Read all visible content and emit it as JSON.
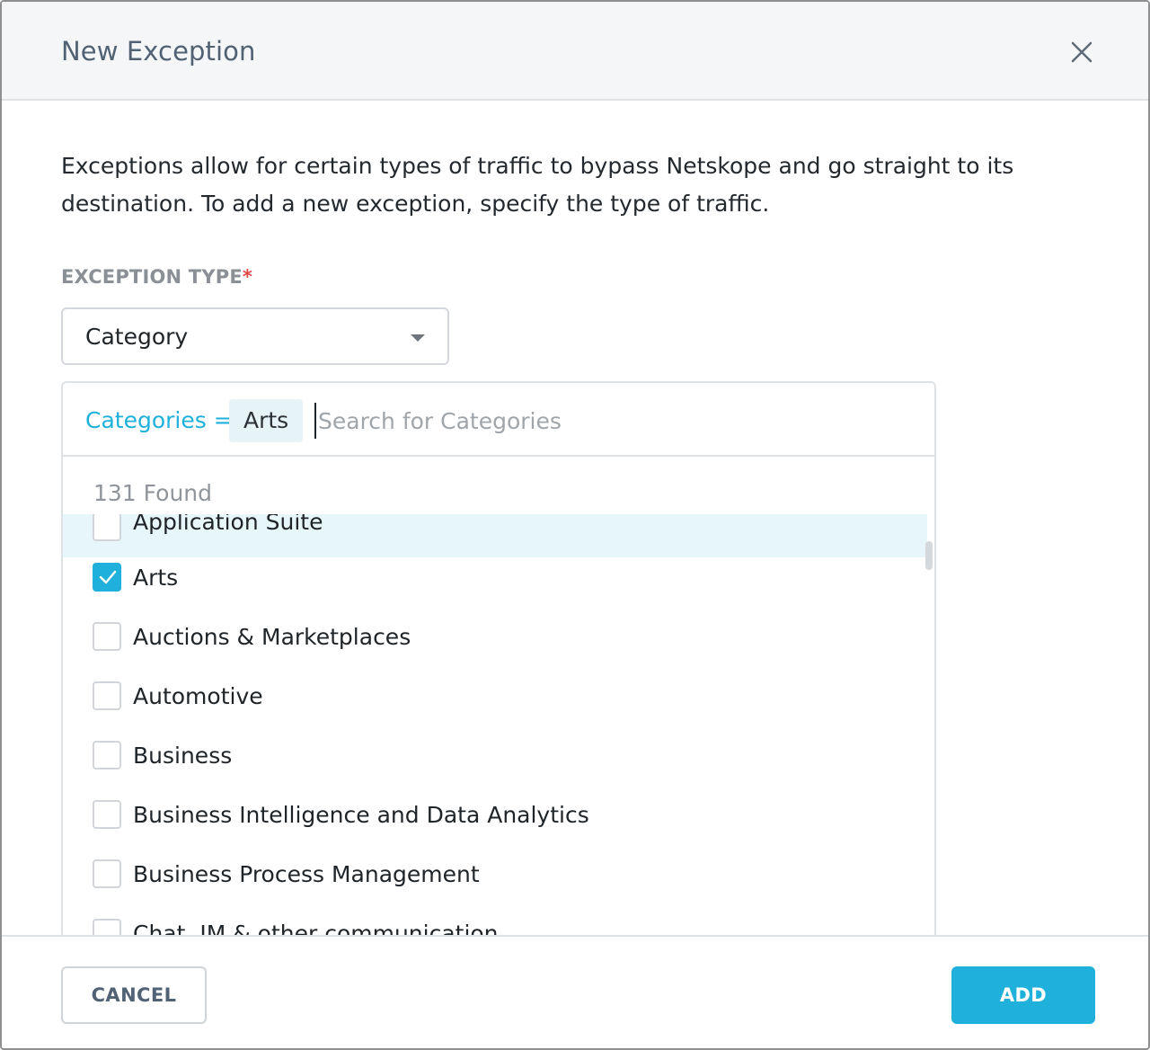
{
  "dialog": {
    "title": "New Exception",
    "close_icon": "close-icon"
  },
  "description": "Exceptions allow for certain types of traffic to bypass Netskope and go straight to its destination. To add a new exception, specify the type of traffic.",
  "exception_type": {
    "label": "EXCEPTION TYPE",
    "required_mark": "*",
    "selected_value": "Category"
  },
  "category_picker": {
    "filter_key": "Categories =",
    "selected_chip": "Arts",
    "search_placeholder": "Search for Categories",
    "found_text": "131 Found",
    "items": [
      {
        "label": "Application Suite",
        "checked": false,
        "highlighted": true
      },
      {
        "label": "Arts",
        "checked": true,
        "highlighted": false
      },
      {
        "label": "Auctions & Marketplaces",
        "checked": false,
        "highlighted": false
      },
      {
        "label": "Automotive",
        "checked": false,
        "highlighted": false
      },
      {
        "label": "Business",
        "checked": false,
        "highlighted": false
      },
      {
        "label": "Business Intelligence and Data Analytics",
        "checked": false,
        "highlighted": false
      },
      {
        "label": "Business Process Management",
        "checked": false,
        "highlighted": false
      },
      {
        "label": "Chat, IM & other communication",
        "checked": false,
        "highlighted": false
      }
    ]
  },
  "footer": {
    "cancel_label": "CANCEL",
    "add_label": "ADD"
  },
  "colors": {
    "accent": "#1fb1db",
    "required": "#e04848",
    "title": "#526275",
    "highlight_row": "#e7f6fa"
  }
}
